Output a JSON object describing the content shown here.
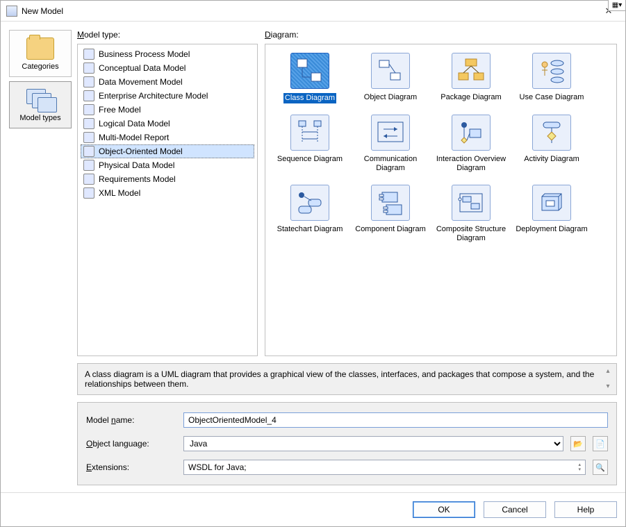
{
  "window": {
    "title": "New Model"
  },
  "sideTabs": [
    {
      "label": "Categories"
    },
    {
      "label": "Model types"
    }
  ],
  "headers": {
    "modelType": "Model type:",
    "diagram": "Diagram:"
  },
  "modelTypes": [
    {
      "label": "Business Process Model"
    },
    {
      "label": "Conceptual Data Model"
    },
    {
      "label": "Data Movement Model"
    },
    {
      "label": "Enterprise Architecture Model"
    },
    {
      "label": "Free Model"
    },
    {
      "label": "Logical Data Model"
    },
    {
      "label": "Multi-Model Report"
    },
    {
      "label": "Object-Oriented Model"
    },
    {
      "label": "Physical Data Model"
    },
    {
      "label": "Requirements Model"
    },
    {
      "label": "XML Model"
    }
  ],
  "diagrams": [
    {
      "label": "Class Diagram"
    },
    {
      "label": "Object Diagram"
    },
    {
      "label": "Package Diagram"
    },
    {
      "label": "Use Case Diagram"
    },
    {
      "label": "Sequence Diagram"
    },
    {
      "label": "Communication Diagram"
    },
    {
      "label": "Interaction Overview Diagram"
    },
    {
      "label": "Activity Diagram"
    },
    {
      "label": "Statechart Diagram"
    },
    {
      "label": "Component Diagram"
    },
    {
      "label": "Composite Structure Diagram"
    },
    {
      "label": "Deployment Diagram"
    }
  ],
  "description": "A class diagram is a UML diagram that provides a graphical view of the classes, interfaces, and packages that compose a system, and the relationships between them.",
  "form": {
    "modelNameLabel": "Model name:",
    "modelNameValue": "ObjectOrientedModel_4",
    "objectLanguageLabel": "Object language:",
    "objectLanguageValue": "Java",
    "extensionsLabel": "Extensions:",
    "extensionsValue": "WSDL for Java;"
  },
  "buttons": {
    "ok": "OK",
    "cancel": "Cancel",
    "help": "Help"
  }
}
